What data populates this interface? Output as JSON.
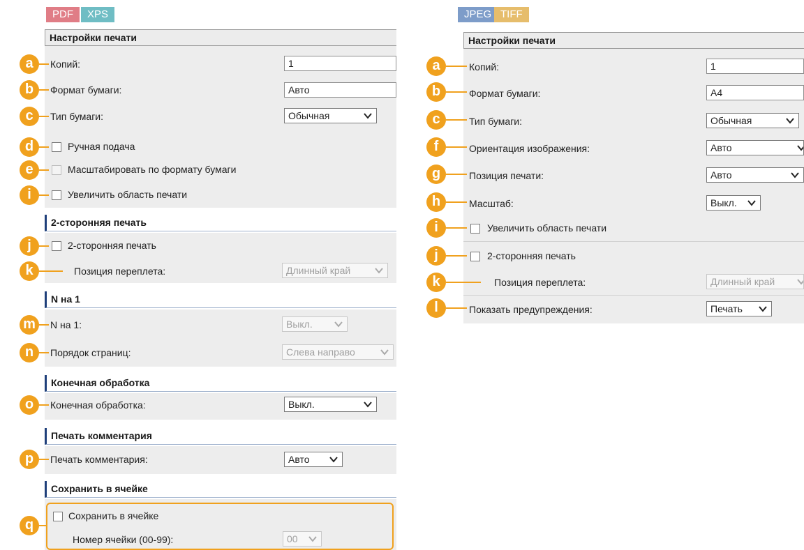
{
  "left": {
    "tags": [
      "PDF",
      "XPS"
    ],
    "section_print": "Настройки печати",
    "copies_label": "Копий:",
    "copies_value": "1",
    "paper_size_label": "Формат бумаги:",
    "paper_size_value": "Авто",
    "paper_type_label": "Тип бумаги:",
    "paper_type_value": "Обычная",
    "manual_feed_label": "Ручная подача",
    "fit_paper_label": "Масштабировать по формату бумаги",
    "enlarge_area_label": "Увеличить область печати",
    "section_duplex": "2-сторонняя печать",
    "duplex_label": "2-сторонняя печать",
    "binding_label": "Позиция переплета:",
    "binding_value": "Длинный край",
    "section_nup": "N на 1",
    "nup_label": "N на 1:",
    "nup_value": "Выкл.",
    "page_order_label": "Порядок страниц:",
    "page_order_value": "Слева направо",
    "section_finishing": "Конечная обработка",
    "finishing_label": "Конечная обработка:",
    "finishing_value": "Выкл.",
    "section_comment": "Печать комментария",
    "comment_label": "Печать комментария:",
    "comment_value": "Авто",
    "section_box": "Сохранить в ячейке",
    "box_label": "Сохранить в ячейке",
    "box_number_label": "Номер ячейки (00-99):",
    "box_number_value": "00"
  },
  "right": {
    "tags": [
      "JPEG",
      "TIFF"
    ],
    "section_print": "Настройки печати",
    "copies_label": "Копий:",
    "copies_value": "1",
    "paper_size_label": "Формат бумаги:",
    "paper_size_value": "A4",
    "paper_type_label": "Тип бумаги:",
    "paper_type_value": "Обычная",
    "orientation_label": "Ориентация изображения:",
    "orientation_value": "Авто",
    "position_label": "Позиция печати:",
    "position_value": "Авто",
    "scale_label": "Масштаб:",
    "scale_value": "Выкл.",
    "enlarge_area_label": "Увеличить область печати",
    "duplex_label": "2-сторонняя печать",
    "binding_label": "Позиция переплета:",
    "binding_value": "Длинный край",
    "warnings_label": "Показать предупреждения:",
    "warnings_value": "Печать"
  },
  "badges": {
    "a": "a",
    "b": "b",
    "c": "c",
    "d": "d",
    "e": "e",
    "f": "f",
    "g": "g",
    "h": "h",
    "i": "i",
    "j": "j",
    "k": "k",
    "l": "l",
    "m": "m",
    "n": "n",
    "o": "o",
    "p": "p",
    "q": "q"
  },
  "colors": {
    "badge": "#f0a11e",
    "section_accent": "#1f3f7a",
    "panel": "#ededed"
  }
}
